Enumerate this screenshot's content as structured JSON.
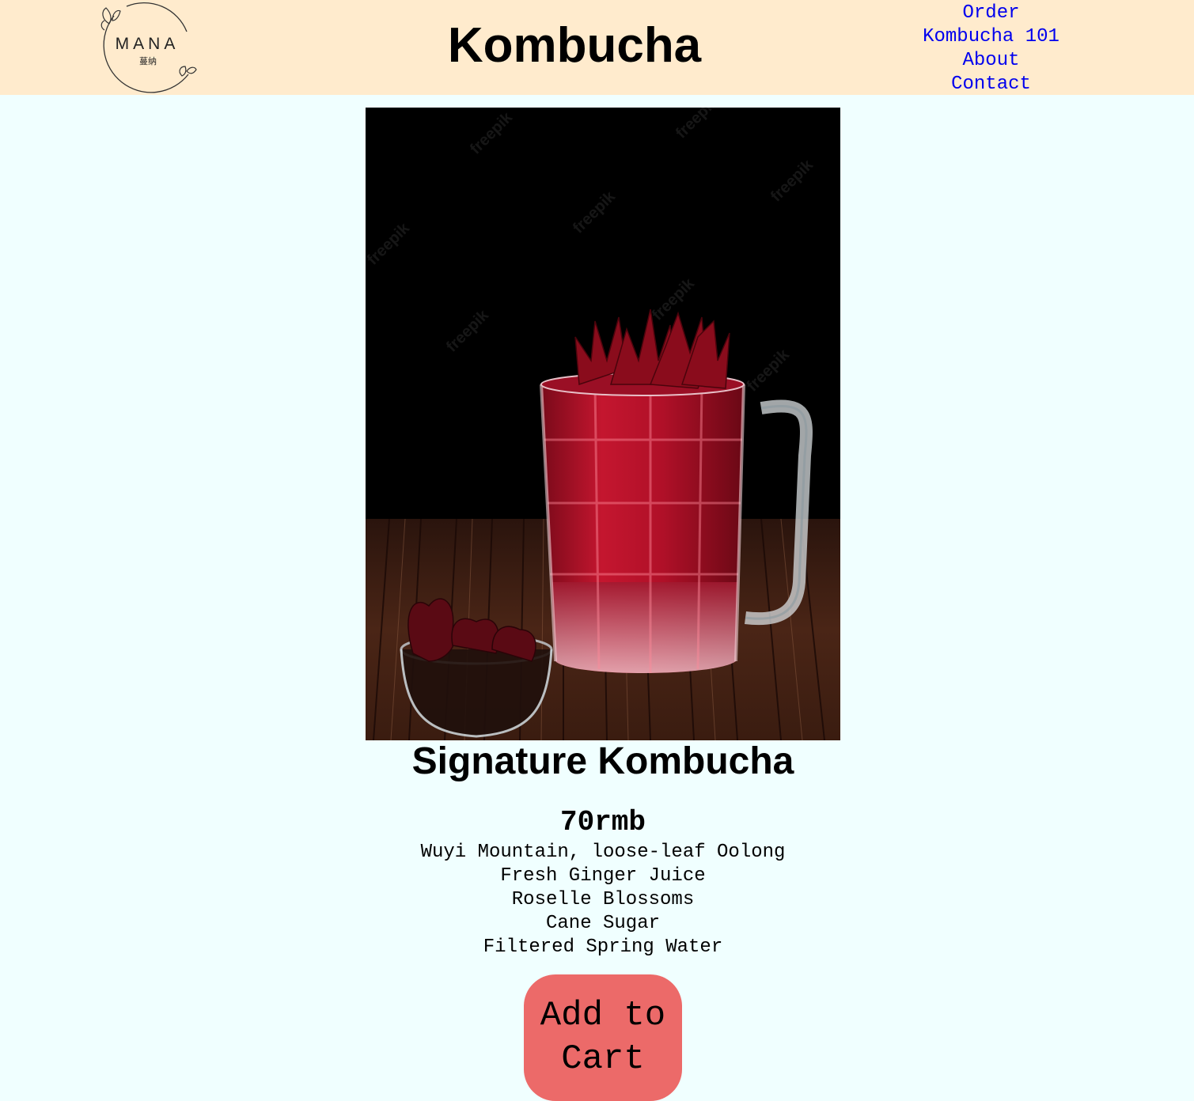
{
  "header": {
    "logo": {
      "wordmark": "MANA",
      "chinese": "蔓纳",
      "icon": "leaf-wreath-logo"
    },
    "title": "Kombucha",
    "nav": [
      {
        "label": "Order"
      },
      {
        "label": "Kombucha 101"
      },
      {
        "label": "About"
      },
      {
        "label": "Contact"
      }
    ]
  },
  "product": {
    "image_alt": "Red roselle kombucha in a glass mug with dried roselle blossoms",
    "name": "Signature Kombucha",
    "price": "70rmb",
    "ingredients": [
      "Wuyi Mountain, loose-leaf Oolong",
      "Fresh Ginger Juice",
      "Roselle Blossoms",
      "Cane Sugar",
      "Filtered Spring Water"
    ],
    "add_to_cart_label": "Add to Cart"
  },
  "colors": {
    "header_bg": "#ffebcd",
    "page_bg": "#f0ffff",
    "link": "#0000ee",
    "button_bg": "#ec6a69"
  }
}
